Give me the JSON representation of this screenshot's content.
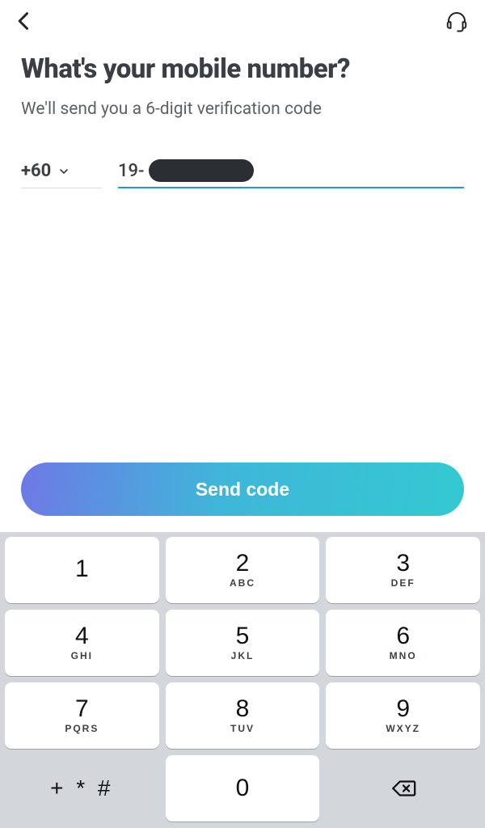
{
  "header": {
    "title": "What's your mobile number?",
    "subtitle": "We'll send you a 6-digit verification code"
  },
  "phone": {
    "country_code": "+60",
    "entered_prefix": "19-"
  },
  "actions": {
    "send_label": "Send code"
  },
  "keypad": {
    "k1": {
      "digit": "1",
      "letters": ""
    },
    "k2": {
      "digit": "2",
      "letters": "ABC"
    },
    "k3": {
      "digit": "3",
      "letters": "DEF"
    },
    "k4": {
      "digit": "4",
      "letters": "GHI"
    },
    "k5": {
      "digit": "5",
      "letters": "JKL"
    },
    "k6": {
      "digit": "6",
      "letters": "MNO"
    },
    "k7": {
      "digit": "7",
      "letters": "PQRS"
    },
    "k8": {
      "digit": "8",
      "letters": "TUV"
    },
    "k9": {
      "digit": "9",
      "letters": "WXYZ"
    },
    "sym": "+ * #",
    "k0": {
      "digit": "0",
      "letters": ""
    }
  }
}
